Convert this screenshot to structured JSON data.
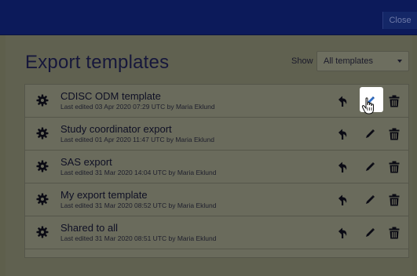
{
  "topbar": {
    "close_label": "Close"
  },
  "dialog": {
    "title": "Export templates",
    "show_label": "Show",
    "show_selected": "All templates"
  },
  "templates": [
    {
      "name": "CDISC ODM template",
      "meta": "Last edited 03 Apr 2020 07:29 UTC by Maria Eklund"
    },
    {
      "name": "Study coordinator export",
      "meta": "Last edited 01 Apr 2020 11:47 UTC by Maria Eklund"
    },
    {
      "name": "SAS export",
      "meta": "Last edited 31 Mar 2020 14:04 UTC by Maria Eklund"
    },
    {
      "name": "My export template",
      "meta": "Last edited 31 Mar 2020 08:52 UTC by Maria Eklund"
    },
    {
      "name": "Shared to all",
      "meta": "Last edited 31 Mar 2020 08:51 UTC by Maria Eklund"
    }
  ],
  "icons": {
    "settings": "gear-icon",
    "revert": "undo-icon",
    "edit": "pencil-icon",
    "delete": "trash-icon",
    "cursor": "hand-pointer-icon"
  },
  "colors": {
    "topbar": "#0c1a5a",
    "overlay": "#5e5f4c",
    "icon": "#0b0b14",
    "edit_highlight_icon": "#2d6cc4"
  }
}
